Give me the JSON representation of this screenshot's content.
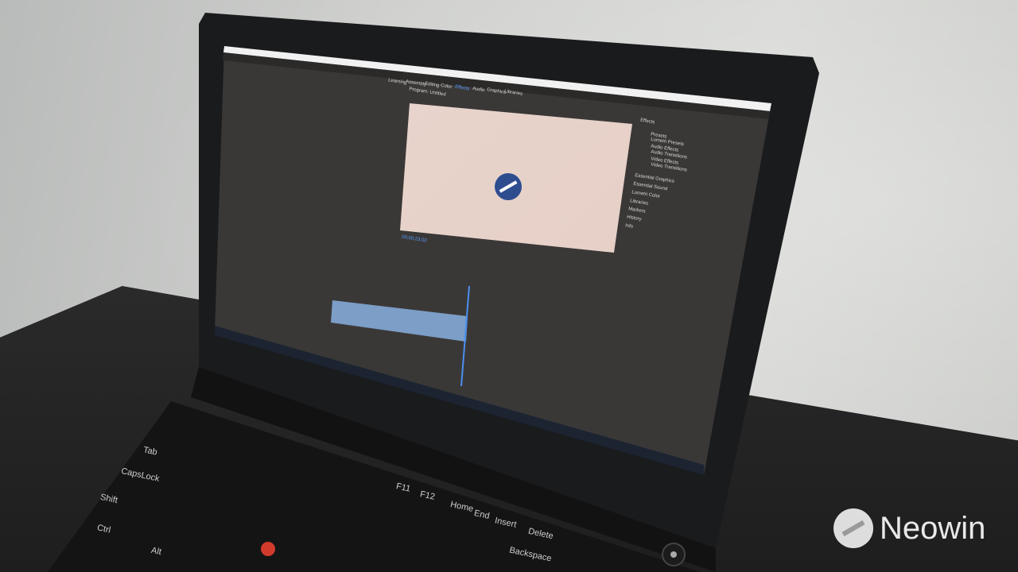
{
  "scene": "Laptop on desk displaying video editing application",
  "watermark": {
    "text": "Neowin"
  },
  "app": {
    "menu_tabs": [
      "Learning",
      "Assembly",
      "Editing",
      "Color",
      "Effects",
      "Audio",
      "Graphics",
      "Libraries"
    ],
    "program_monitor_title": "Program: Untitled",
    "timecode": "00;00;23;02",
    "effects_panel": {
      "title": "Effects",
      "items": [
        "Presets",
        "Lumetri Presets",
        "Audio Effects",
        "Audio Transitions",
        "Video Effects",
        "Video Transitions"
      ],
      "sections": [
        "Essential Graphics",
        "Essential Sound",
        "Lumetri Color",
        "Libraries",
        "Markers",
        "History",
        "Info"
      ]
    }
  },
  "keyboard": {
    "labels": [
      "Tab",
      "CapsLock",
      "Shift",
      "Ctrl",
      "Alt",
      "Home",
      "End",
      "Insert",
      "Delete",
      "Backspace",
      "F11",
      "F12"
    ]
  }
}
